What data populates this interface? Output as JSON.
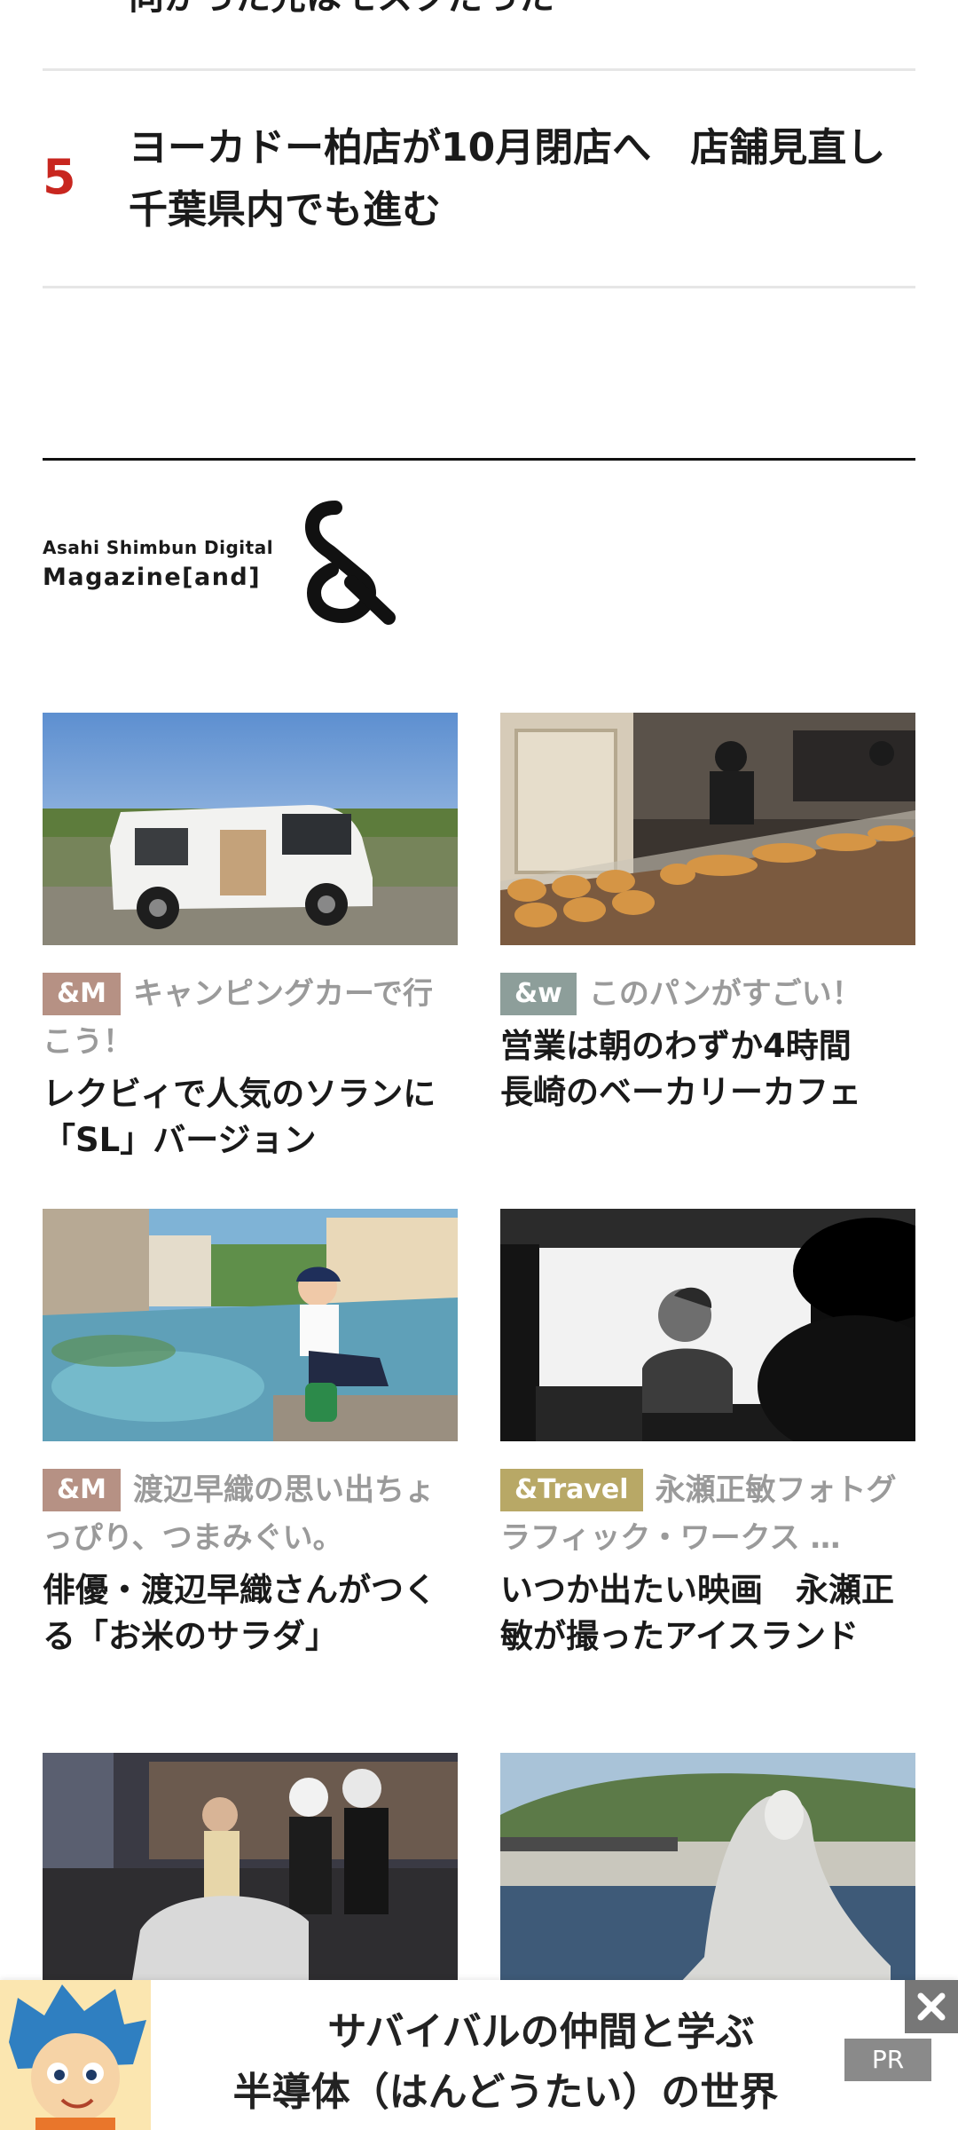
{
  "ranking": {
    "prev_item_title": "向かった先はモスクだった",
    "item5": {
      "number": "5",
      "title": "ヨーカドー柏店が10月閉店へ　店舗見直し千葉県内でも進む"
    }
  },
  "brand": {
    "line1": "Asahi Shimbun Digital",
    "line2": "Magazine[and]",
    "mark": "&"
  },
  "colors": {
    "rank_number": "#c8261f",
    "tag_m": "#b69184",
    "tag_w": "#8d9e9a",
    "tag_travel": "#b8a866",
    "meta_text": "#9a9a9a",
    "pr_badge": "#8a8a8a"
  },
  "articles": [
    {
      "tag": "&M",
      "series": "キャンピングカーで行こう！",
      "headline": "レクビィで人気のソランに「SL」バージョン",
      "image": "white-camper-van-photo"
    },
    {
      "tag": "&w",
      "series": "このパンがすごい！",
      "headline": "営業は朝のわずか4時間　長崎のベーカリーカフェ",
      "image": "bakery-counter-photo"
    },
    {
      "tag": "&M",
      "series": "渡辺早織の思い出ちょっぴり、つまみぐい。",
      "headline": "俳優・渡辺早織さんがつくる「お米のサラダ」",
      "image": "spring-pond-woman-photo"
    },
    {
      "tag": "&Travel",
      "series": "永瀬正敏フォトグラフィック・ワークス …",
      "headline": "いつか出たい映画　永瀬正敏が撮ったアイスランド",
      "image": "monochrome-car-interior-photo"
    },
    {
      "image": "scooter-riders-night-photo"
    },
    {
      "image": "stone-statue-seaside-photo"
    }
  ],
  "ad": {
    "line1": "サバイバルの仲間と学ぶ",
    "line2": "半導体（はんどうたい）の世界",
    "pr_label": "PR",
    "close_icon": "close-icon"
  }
}
